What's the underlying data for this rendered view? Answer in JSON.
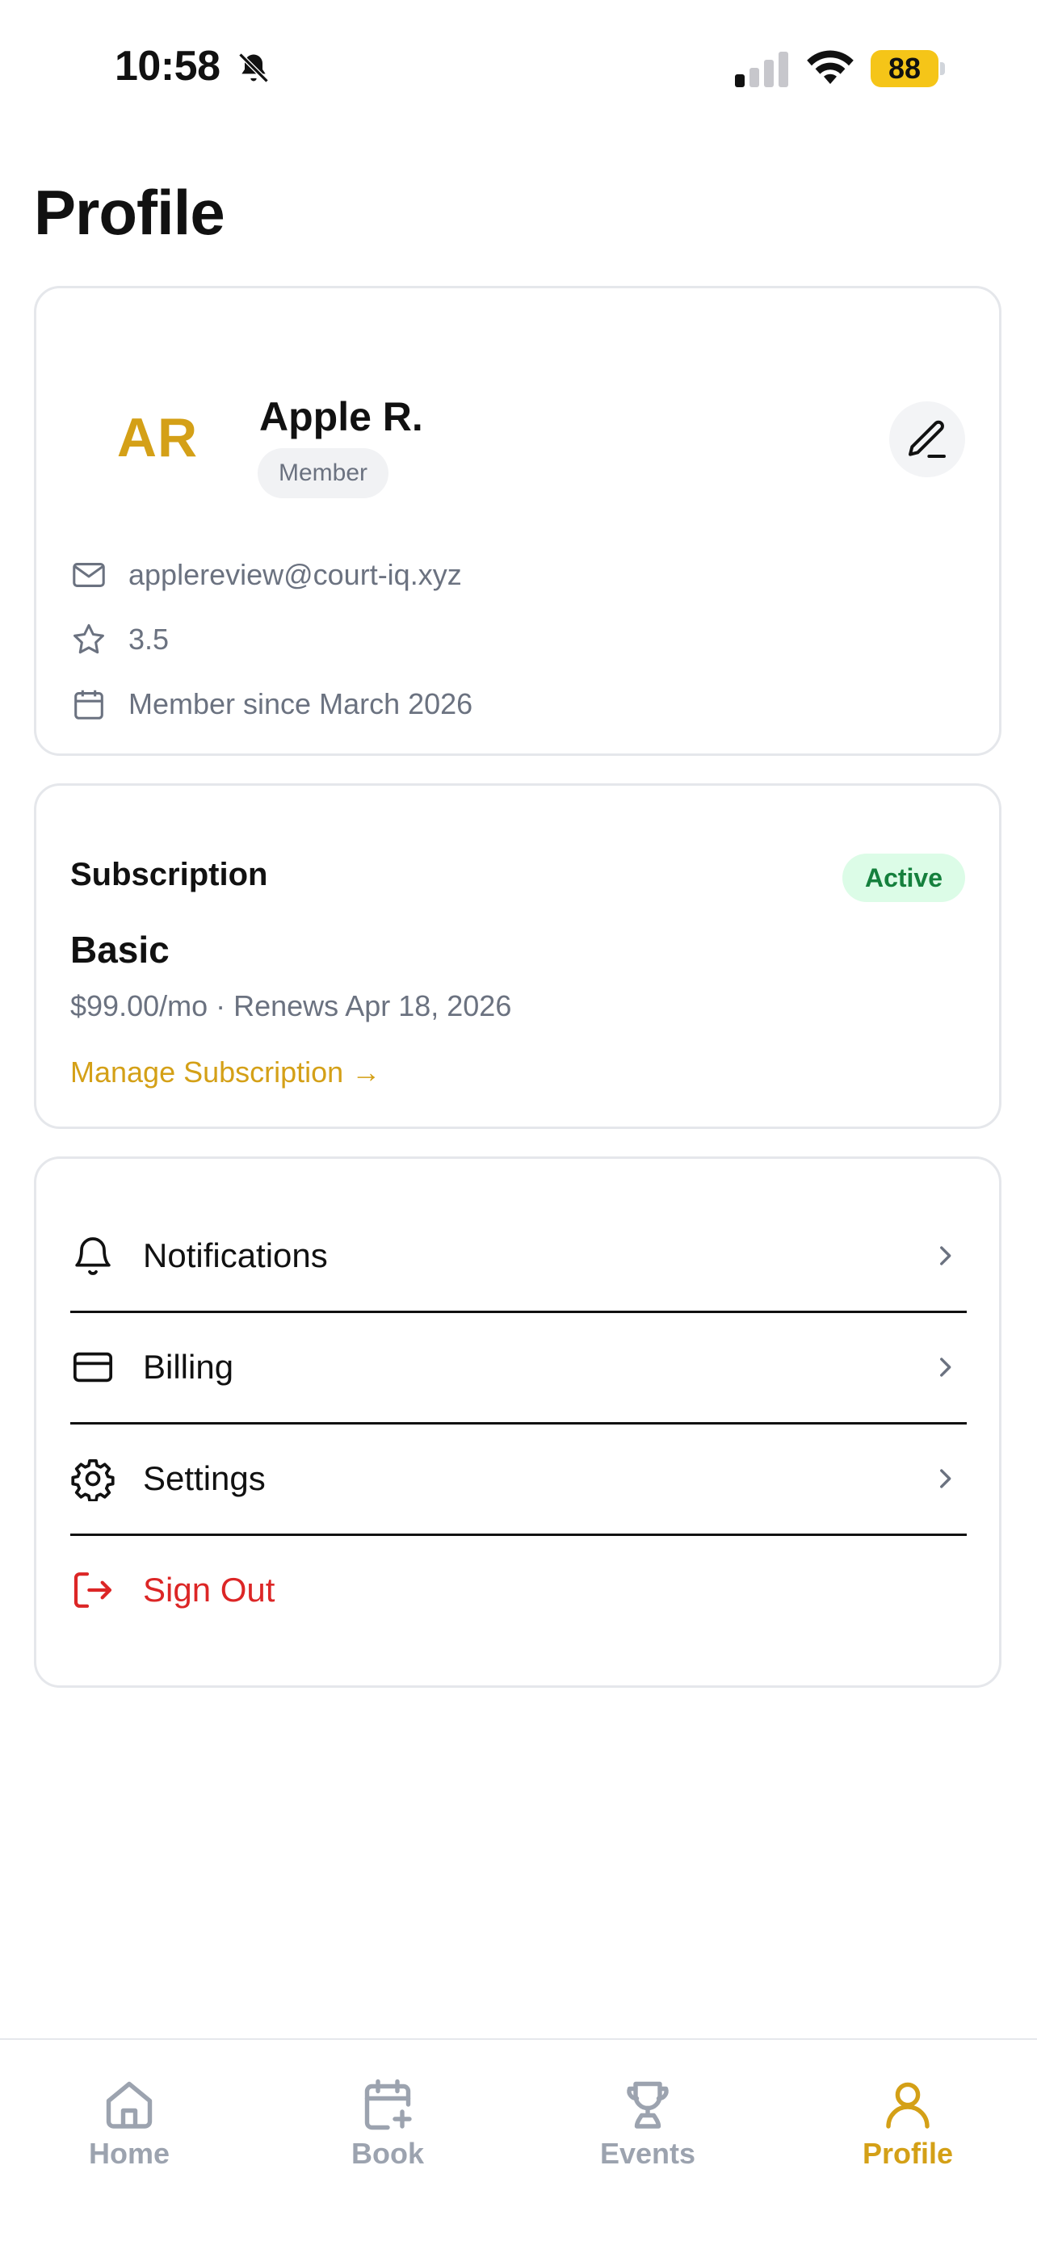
{
  "status_bar": {
    "time": "10:58",
    "battery": "88"
  },
  "page_title": "Profile",
  "profile": {
    "initials": "AR",
    "name": "Apple R.",
    "role": "Member",
    "email": "applereview@court-iq.xyz",
    "rating": "3.5",
    "member_since": "Member since March 2026"
  },
  "subscription": {
    "heading": "Subscription",
    "status": "Active",
    "plan": "Basic",
    "price_renewal": "$99.00/mo · Renews Apr 18, 2026",
    "manage_link": "Manage Subscription →"
  },
  "menu": {
    "notifications": "Notifications",
    "billing": "Billing",
    "settings": "Settings",
    "sign_out": "Sign Out"
  },
  "tabs": {
    "home": "Home",
    "book": "Book",
    "events": "Events",
    "profile": "Profile"
  },
  "colors": {
    "accent": "#d4a017",
    "active_badge_bg": "#dcfce7",
    "active_badge_text": "#15803d",
    "danger": "#dc2626",
    "muted_text": "#6b7280"
  }
}
